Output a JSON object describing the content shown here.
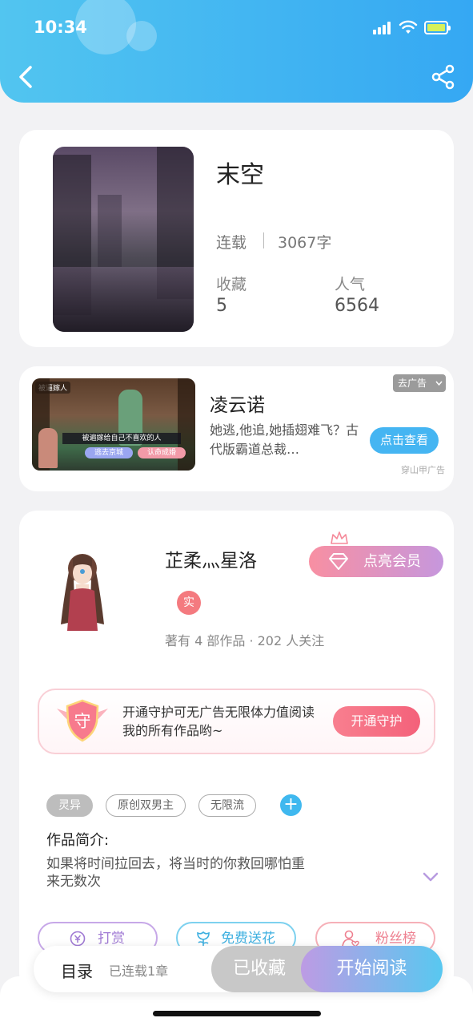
{
  "status_bar": {
    "time": "10:34"
  },
  "book": {
    "title": "末空",
    "status": "连载",
    "word_count": "3067字",
    "favorites_label": "收藏",
    "favorites_value": "5",
    "popularity_label": "人气",
    "popularity_value": "6564"
  },
  "ad": {
    "title": "凌云诺",
    "description": "她逃,他追,她插翅难飞？古代版霸道总裁…",
    "button": "点击查看",
    "close_label": "去广告",
    "source": "穿山甲广告",
    "image_caption": "被遍嫁给自己不喜欢的人",
    "image_choice_1": "逃去京城",
    "image_choice_2": "认命成婚",
    "image_corner": "被逼嫁人"
  },
  "author": {
    "name": "芷柔灬星洛",
    "badge": "实",
    "meta": "著有 4 部作品 · 202 人关注",
    "vip_button": "点亮会员"
  },
  "guard": {
    "shield_char": "守",
    "text": "开通守护可无广告无限体力值阅读我的所有作品哟~",
    "button": "开通守护"
  },
  "tags": [
    "灵异",
    "原创双男主",
    "无限流"
  ],
  "intro": {
    "label": "作品简介:",
    "text": "如果将时间拉回去，将当时的你救回哪怕重来无数次"
  },
  "actions": {
    "tip": "打赏",
    "flower": "免费送花",
    "fans": "粉丝榜"
  },
  "bottom_bar": {
    "toc": "目录",
    "chapters": "已连载1章",
    "collected": "已收藏",
    "start_reading": "开始阅读"
  },
  "colors": {
    "header_gradient": [
      "#52c5f0",
      "#35a8f3"
    ],
    "accent_blue": "#45b5f2",
    "vip_gradient": [
      "#f88fa2",
      "#c697dd"
    ],
    "guard_red": "#f4617a"
  }
}
